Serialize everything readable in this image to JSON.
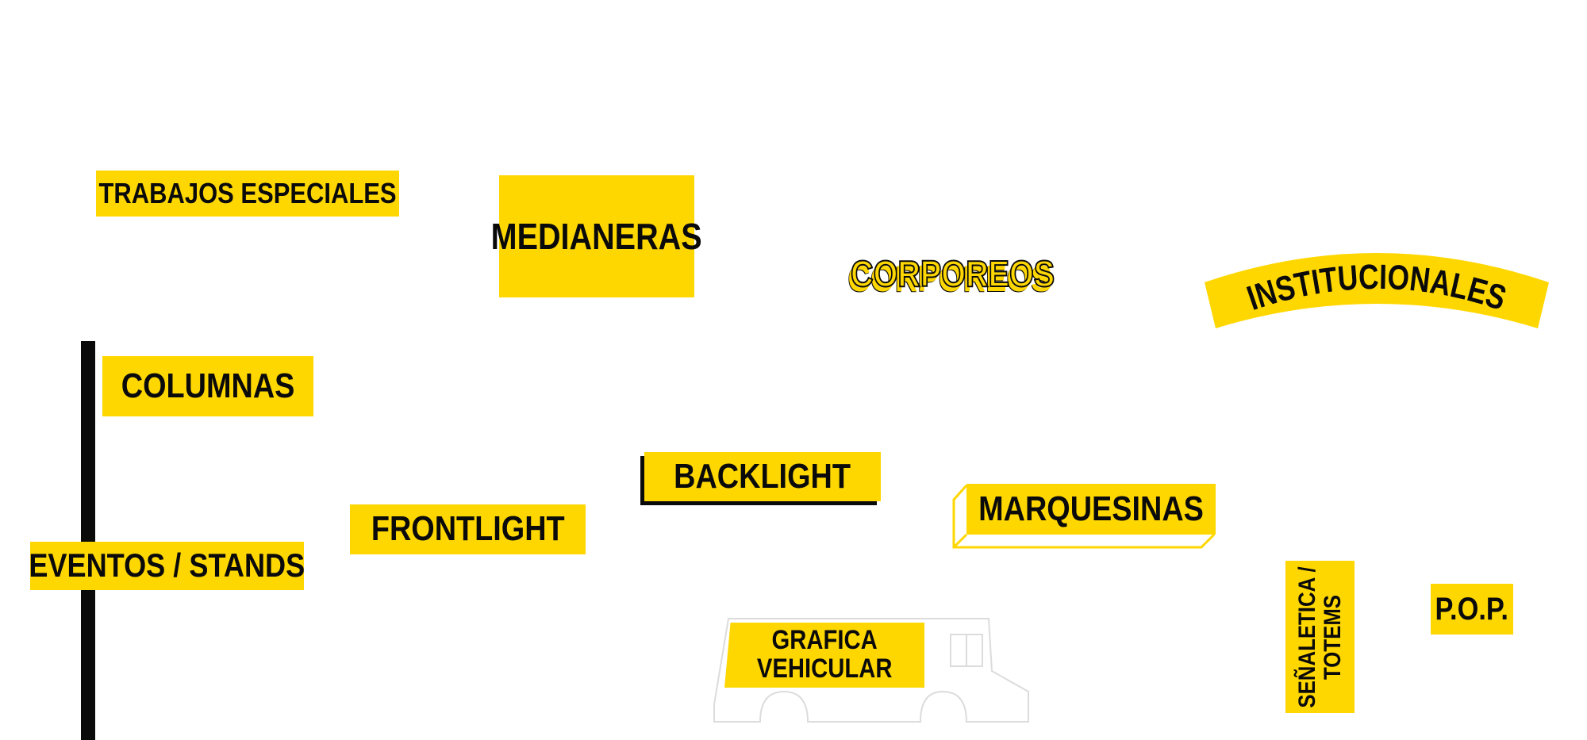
{
  "colors": {
    "accent": "#ffd700",
    "text": "#0a0a0a",
    "background": "#ffffff",
    "line": "#0a0a0a",
    "vehicle_outline": "#dcdcdc"
  },
  "categories": {
    "trabajos_especiales": "TRABAJOS ESPECIALES",
    "medianeras": "MEDIANERAS",
    "corporeos": "CORPOREOS",
    "institucionales": "INSTITUCIONALES",
    "columnas": "COLUMNAS",
    "backlight": "BACKLIGHT",
    "marquesinas": "MARQUESINAS",
    "frontlight": "FRONTLIGHT",
    "eventos_stands": "EVENTOS / STANDS",
    "grafica_vehicular_line1": "GRAFICA",
    "grafica_vehicular_line2": "VEHICULAR",
    "senaletica_line1": "SEÑALETICA /",
    "senaletica_line2": "TOTEMS",
    "pop": "P.O.P."
  },
  "icons": {
    "vehicle": "truck-outline-icon",
    "timeline": "vertical-bar"
  }
}
